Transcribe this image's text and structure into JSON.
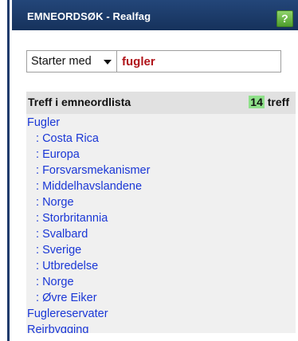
{
  "titlebar": {
    "title": "EMNEORDSØK - Realfag",
    "help_label": "?"
  },
  "search": {
    "mode": "Starter med",
    "query": "fugler"
  },
  "results": {
    "heading": "Treff i emneordlista",
    "count": "14",
    "count_suffix": " treff",
    "items": [
      {
        "label": "Fugler",
        "level": 0
      },
      {
        "label": "Costa Rica",
        "level": 1
      },
      {
        "label": "Europa",
        "level": 1
      },
      {
        "label": "Forsvarsmekanismer",
        "level": 1
      },
      {
        "label": "Middelhavslandene",
        "level": 1
      },
      {
        "label": "Norge",
        "level": 1
      },
      {
        "label": "Storbritannia",
        "level": 1
      },
      {
        "label": "Svalbard",
        "level": 1
      },
      {
        "label": "Sverige",
        "level": 1
      },
      {
        "label": "Utbredelse",
        "level": 1
      },
      {
        "label": "Norge",
        "level": 1
      },
      {
        "label": "Øvre Eiker",
        "level": 1
      },
      {
        "label": "Fuglereservater",
        "level": 0
      },
      {
        "label": "Reirbygging",
        "level": 0
      }
    ],
    "sub_prefix": ": "
  }
}
